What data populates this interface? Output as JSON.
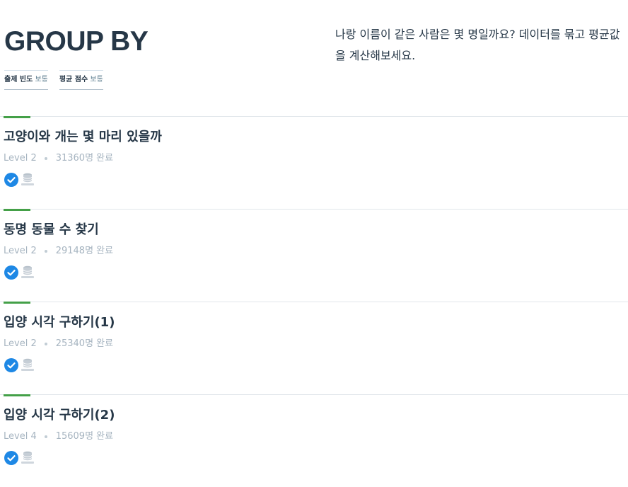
{
  "header": {
    "title": "GROUP BY",
    "description": "나랑 이름이 같은 사람은 몇 명일까요? 데이터를 묶고 평균값을 계산해보세요.",
    "tags": [
      {
        "key": "출제 빈도",
        "value": "보통"
      },
      {
        "key": "평균 점수",
        "value": "보통"
      }
    ]
  },
  "problems": [
    {
      "title": "고양이와 개는 몇 마리 있을까",
      "level": "Level 2",
      "completed": "31360명 완료",
      "status_icon": "check-circle-icon",
      "db_icon": "oracle-database-icon"
    },
    {
      "title": "동명 동물 수 찾기",
      "level": "Level 2",
      "completed": "29148명 완료",
      "status_icon": "check-circle-icon",
      "db_icon": "oracle-database-icon"
    },
    {
      "title": "입양 시각 구하기(1)",
      "level": "Level 2",
      "completed": "25340명 완료",
      "status_icon": "check-circle-icon",
      "db_icon": "oracle-database-icon"
    },
    {
      "title": "입양 시각 구하기(2)",
      "level": "Level 4",
      "completed": "15609명 완료",
      "status_icon": "check-circle-icon",
      "db_icon": "oracle-database-icon"
    }
  ],
  "colors": {
    "accent_green": "#44a048",
    "check_blue": "#1e88e5",
    "title_dark": "#263747",
    "meta_gray": "#a6b4c0"
  }
}
